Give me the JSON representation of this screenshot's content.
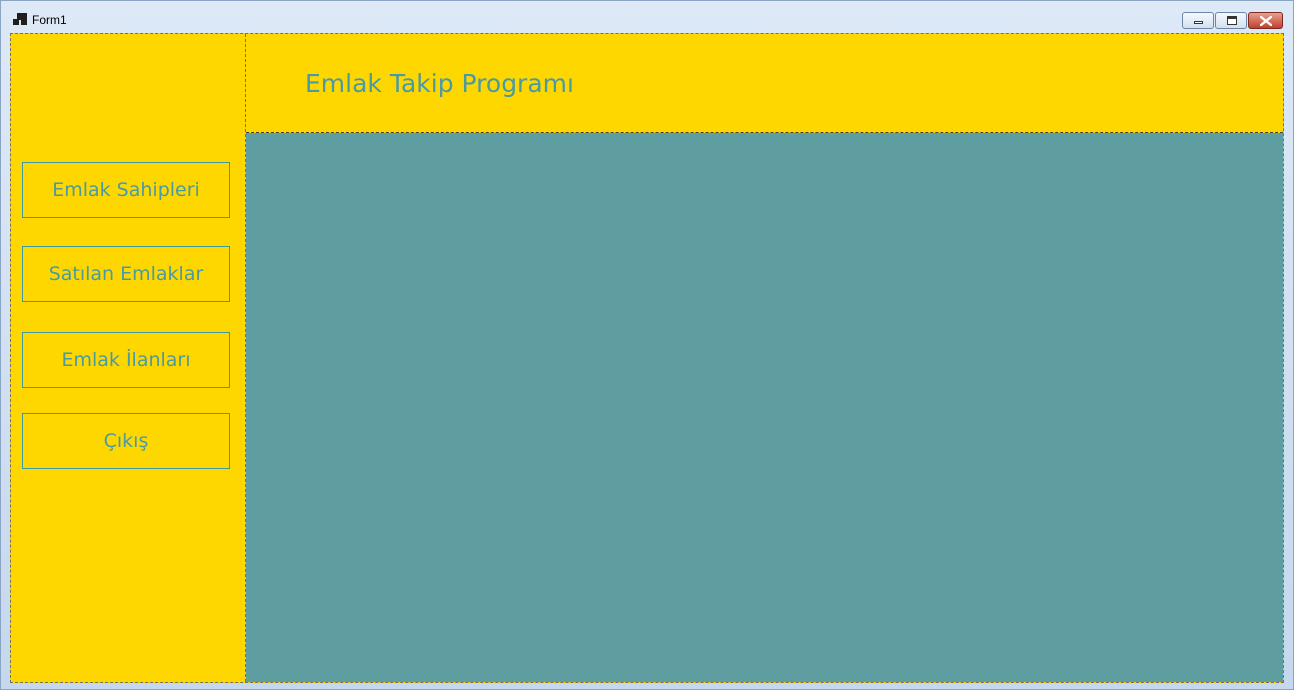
{
  "window": {
    "title": "Form1",
    "icon": "form-icon",
    "controls": [
      "minimize-icon",
      "maximize-icon",
      "close-icon"
    ]
  },
  "header": {
    "title": "Emlak Takip Programı"
  },
  "sidebar": {
    "items": [
      {
        "label": "Emlak Sahipleri"
      },
      {
        "label": "Satılan Emlaklar"
      },
      {
        "label": "Emlak İlanları"
      },
      {
        "label": "Çıkış"
      }
    ]
  },
  "colors": {
    "panel": "#ffd700",
    "content": "#5f9ea0",
    "text": "#4a9aa4"
  }
}
